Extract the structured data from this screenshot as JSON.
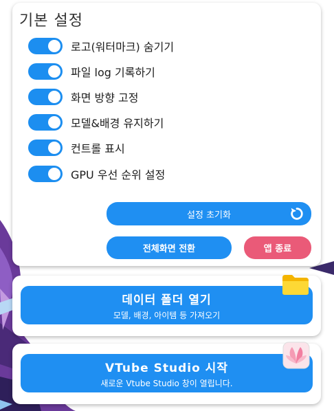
{
  "settings": {
    "title": "기본 설정",
    "toggles": [
      {
        "label": "로고(워터마크) 숨기기",
        "on": true
      },
      {
        "label": "파일 log 기록하기",
        "on": true
      },
      {
        "label": "화면 방향 고정",
        "on": true
      },
      {
        "label": "모델&배경 유지하기",
        "on": true
      },
      {
        "label": "컨트롤 표시",
        "on": true
      },
      {
        "label": "GPU 우선 순위 설정",
        "on": true
      }
    ],
    "reset_label": "설정 초기화",
    "fullscreen_label": "전체화면 전환",
    "quit_label": "앱 종료"
  },
  "folder": {
    "title": "데이터 폴더 열기",
    "subtitle": "모델, 배경, 아이템 등 가져오기",
    "icon": "folder-icon"
  },
  "vts": {
    "title": "VTube Studio 시작",
    "subtitle": "새로운 Vtube Studio 창이 열립니다.",
    "icon": "vtube-studio-logo-icon"
  },
  "colors": {
    "accent": "#1f8ff2",
    "danger": "#ea5a78"
  }
}
